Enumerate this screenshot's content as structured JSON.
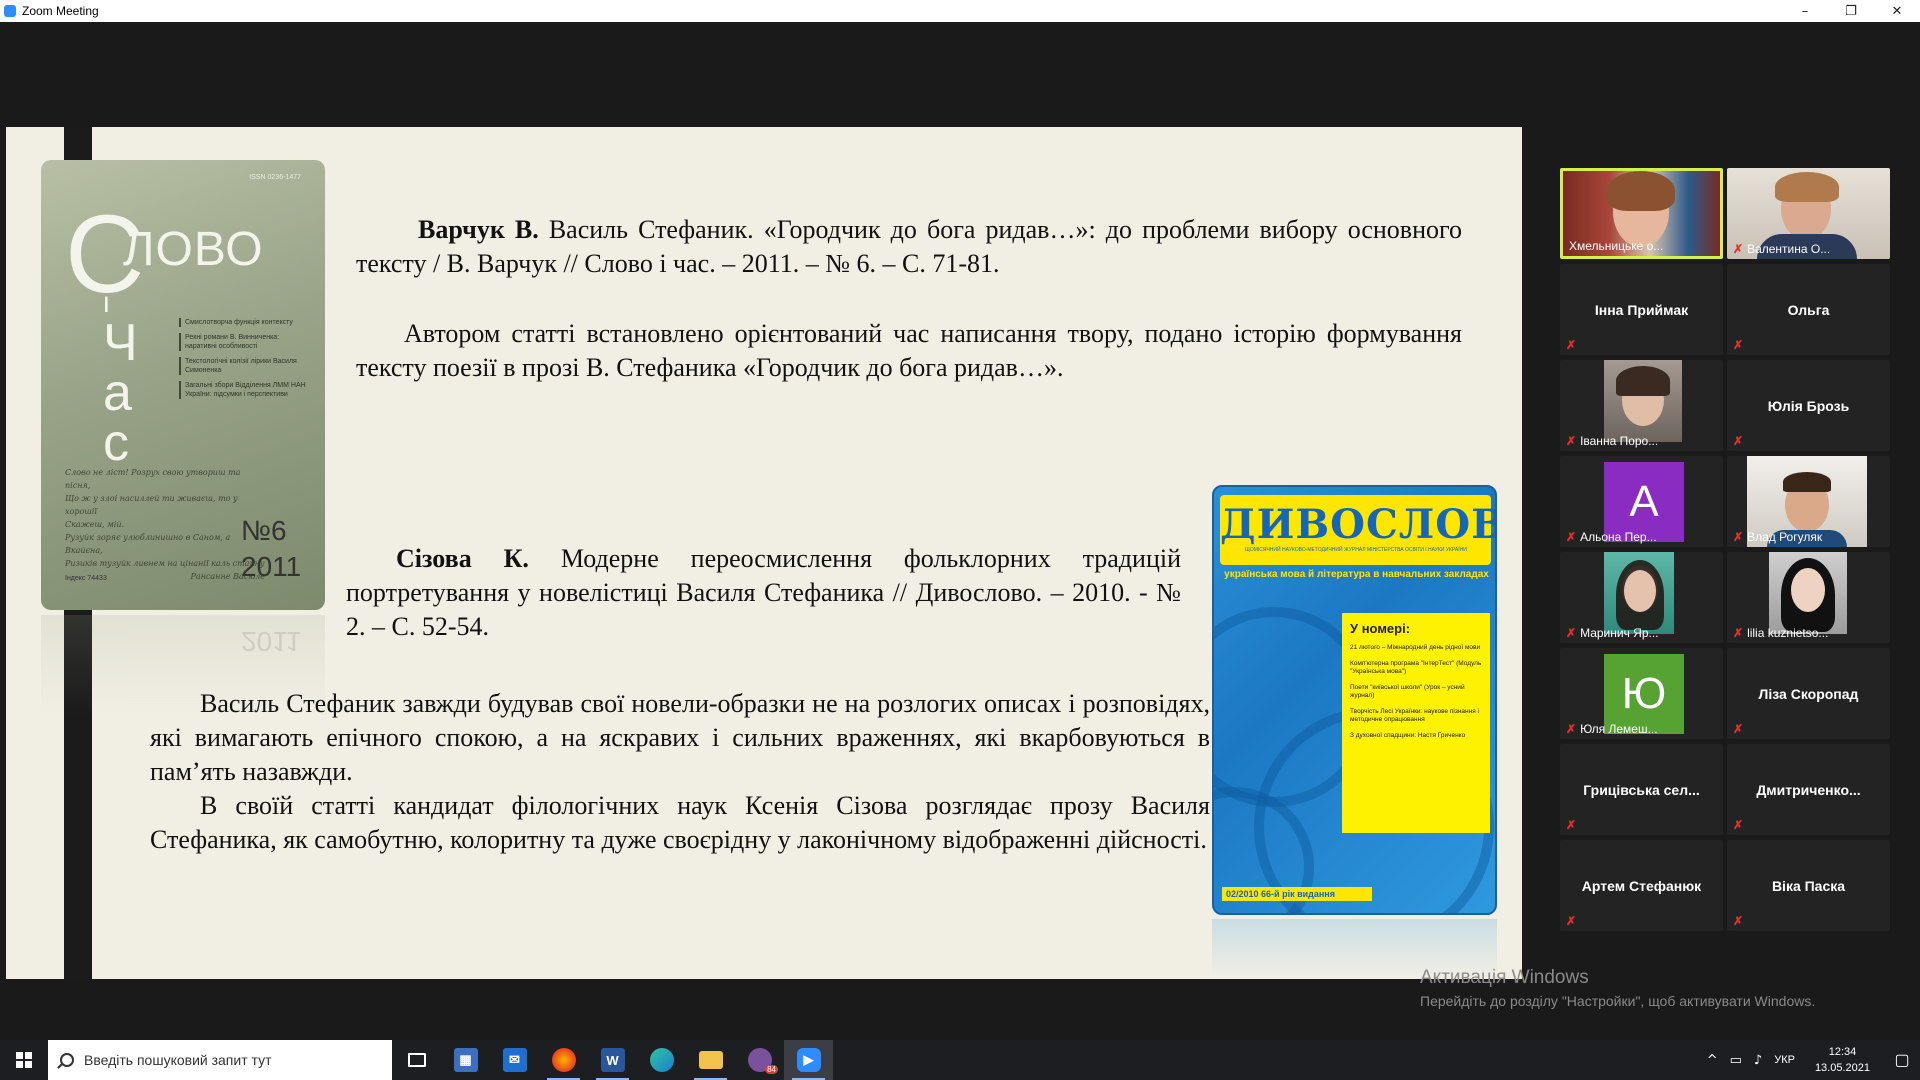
{
  "window": {
    "title": "Zoom Meeting",
    "controls": [
      "–",
      "❐",
      "✕"
    ]
  },
  "slide": {
    "cover1": {
      "issn": "ISSN 0236-1477",
      "c_letter": "С",
      "lovo": "ЛОВО",
      "vertical": [
        "і",
        "Ч",
        "а",
        "с"
      ],
      "contents": [
        "Смислотворча функція контексту",
        "Рекні романи В. Винниченка: наративні особливості",
        "Текстологічні колізії лірики Василя Симоненка",
        "Загальні збори Відділення ЛММ НАН України: підсумки і перспективи"
      ],
      "script_lines": [
        "Слово не ліст! Розрух свою утвориш та пісня,",
        "Що ж у злоі насиллей ти живаєш, то у хорошії",
        "Скажеш, мій.",
        "Рузуйк зоряє улюблинишно в Саном, а Вкайєна,",
        "Ризиків тузуйк ливнем на цінанії каль стапну",
        "Рансанне Васюле"
      ],
      "issue": "№6",
      "year": "2011",
      "index": "Індекс 74433"
    },
    "para1": {
      "author": "Варчук В.",
      "rest": " Василь Стефаник. «Городчик до бога ридав…»: до проблеми вибору основного тексту / В. Варчук // Слово і час. – 2011. – № 6. – С. 71-81."
    },
    "para2": "Автором статті встановлено орієнтований час написання твору, подано історію формування тексту поезії в прозі В. Стефаника «Городчик до бога ридав…».",
    "para3": {
      "author": "Сізова К.",
      "rest": " Модерне переосмислення фольклорних традицій портретування у новелістиці Василя Стефаника // Дивослово. – 2010. - № 2. – С. 52-54."
    },
    "para4": "Василь Стефаник завжди будував свої новели-образки не на розлогих описах і розповідях, які вимагають епічного спокою, а на яскравих і сильних враженнях, які вкарбовуються в пам’ять назавжди.",
    "para5": "В своїй статті кандидат філологічних наук Ксенія Сізова розглядає прозу Василя Стефаника, як самобутню, колоритну та дуже своєрідну у лаконічному відображенні дійсності.",
    "cover2": {
      "title": "ДИВОСЛОВО",
      "subtitle": "ЩОМІСЯЧНИЙ НАУКОВО-МЕТОДИЧНИЙ ЖУРНАЛ МІНІСТЕРСТВА ОСВІТИ І НАУКИ УКРАЇНИ",
      "strip": "українська мова й література в навчальних закладах",
      "panel_head": "У номері:",
      "panel_items": [
        "21 лютого – Міжнародний день рідної мови",
        "Комп'ютерна програма \"ІнтерТест\" (Модуль \"Українська мова\")",
        "Поети \"київської школи\" (Урок – усний журнал)",
        "Творчість Лесі Українки: наукове пізнання і методичне опрацювання",
        "З духовної спадщини: Настя Гриченко"
      ],
      "footer": "02/2010  66-й рік видання"
    }
  },
  "participants": [
    {
      "name": "Хмельницьке о...",
      "kind": "video",
      "active": true,
      "muted": false
    },
    {
      "name": "Валентина О...",
      "kind": "video",
      "active": false,
      "muted": true
    },
    {
      "name": "Інна Приймак",
      "kind": "name",
      "muted": true
    },
    {
      "name": "Ольга",
      "kind": "name",
      "muted": true
    },
    {
      "name": "Іванна Поро...",
      "kind": "video",
      "muted": true
    },
    {
      "name": "Юлія Брозь",
      "kind": "name",
      "muted": true
    },
    {
      "name": "Альона Пер...",
      "kind": "letter",
      "letter": "А",
      "color": "#8a2bc2",
      "muted": true
    },
    {
      "name": "Влад Рогуляк",
      "kind": "video",
      "muted": true
    },
    {
      "name": "Маринич Яр...",
      "kind": "video",
      "muted": true
    },
    {
      "name": "lilia kuznietso...",
      "kind": "video",
      "muted": true
    },
    {
      "name": "Юля Лемеш...",
      "kind": "letter",
      "letter": "Ю",
      "color": "#56a233",
      "muted": true
    },
    {
      "name": "Ліза Скоропад",
      "kind": "name",
      "muted": true
    },
    {
      "name": "Грицівська сел...",
      "kind": "name",
      "muted": true
    },
    {
      "name": "Дмитриченко...",
      "kind": "name",
      "muted": true
    },
    {
      "name": "Артем Стефанюк",
      "kind": "name",
      "muted": true
    },
    {
      "name": "Віка Паска",
      "kind": "name",
      "muted": true
    }
  ],
  "watermark": {
    "line1": "Активація Windows",
    "line2": "Перейдіть до розділу \"Настройки\", щоб активувати Windows."
  },
  "taskbar": {
    "search_placeholder": "Введіть пошуковий запит тут",
    "viber_badge": "84",
    "language": "УКР",
    "time": "12:34",
    "date": "13.05.2021"
  },
  "colors": {
    "accent_active": "#d6f04b",
    "mute": "#e0332e",
    "slide_bg": "#f1efe4"
  }
}
